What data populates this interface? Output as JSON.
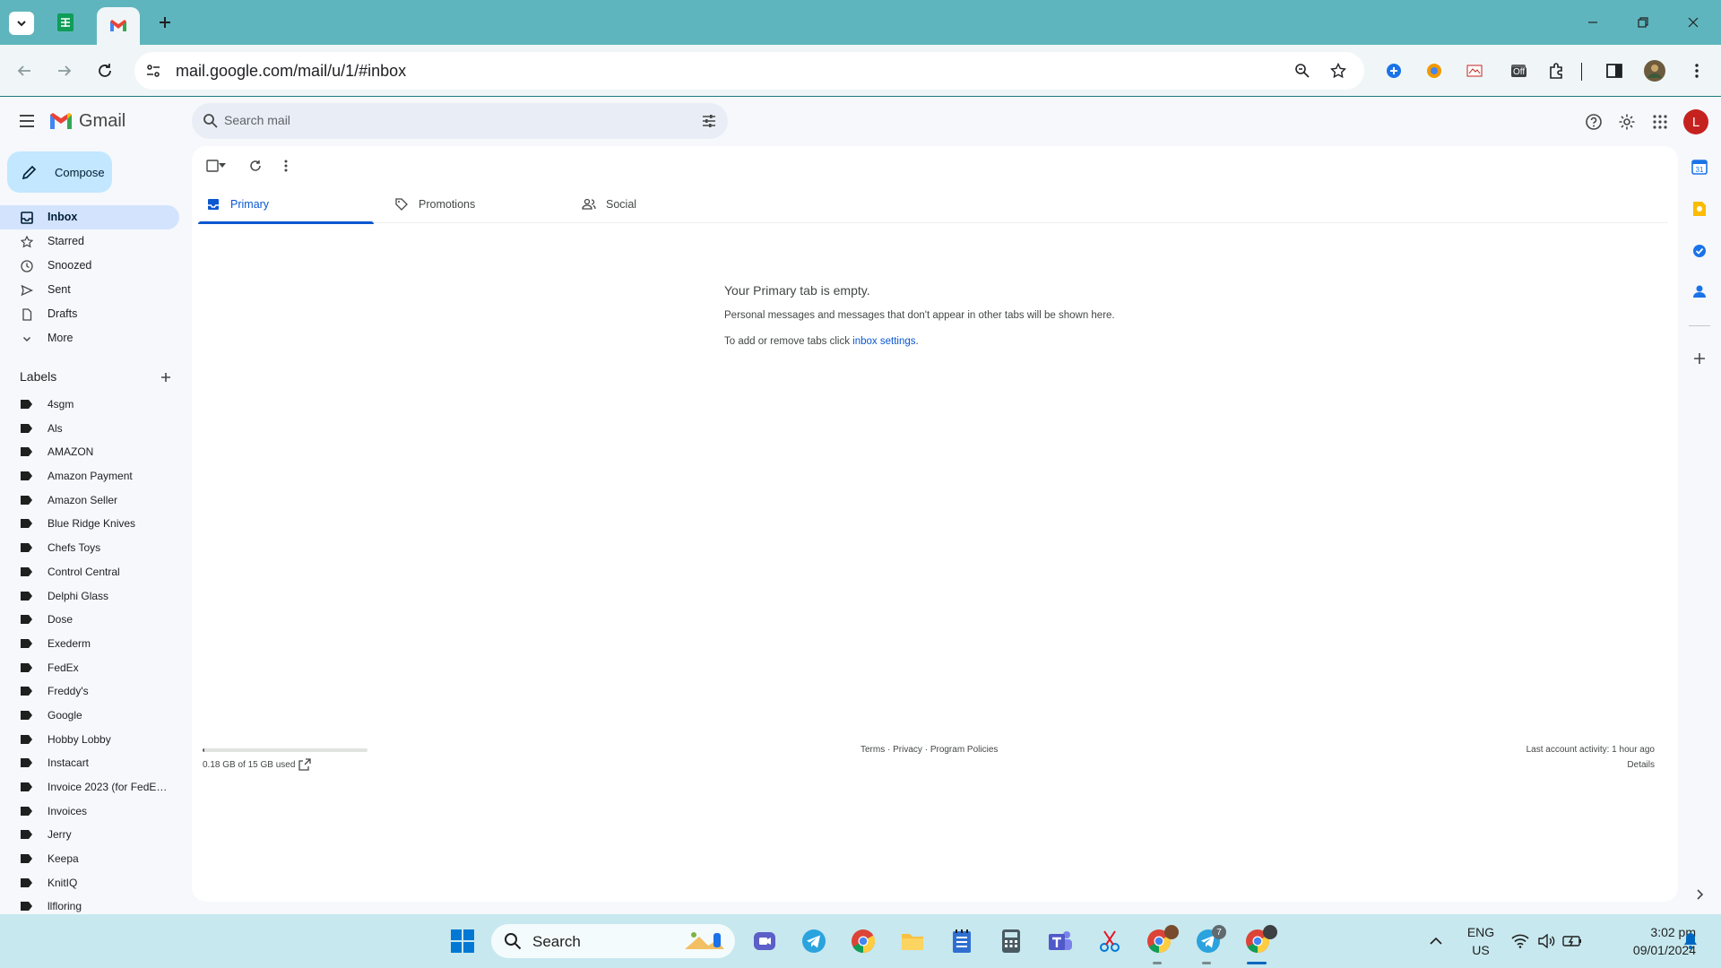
{
  "browser": {
    "url": "mail.google.com/mail/u/1/#inbox"
  },
  "gmail": {
    "app_name": "Gmail",
    "search_placeholder": "Search mail",
    "avatar_letter": "L",
    "compose_label": "Compose",
    "nav": [
      {
        "label": "Inbox",
        "icon": "inbox-icon",
        "active": true
      },
      {
        "label": "Starred",
        "icon": "star-icon"
      },
      {
        "label": "Snoozed",
        "icon": "clock-icon"
      },
      {
        "label": "Sent",
        "icon": "send-icon"
      },
      {
        "label": "Drafts",
        "icon": "draft-icon"
      },
      {
        "label": "More",
        "icon": "chevron-down-icon"
      }
    ],
    "labels_heading": "Labels",
    "labels": [
      "4sgm",
      "Als",
      "AMAZON",
      "Amazon Payment",
      "Amazon Seller",
      "Blue Ridge Knives",
      "Chefs Toys",
      "Control Central",
      "Delphi Glass",
      "Dose",
      "Exederm",
      "FedEx",
      "Freddy's",
      "Google",
      "Hobby Lobby",
      "Instacart",
      "Invoice 2023 (for FedEx ...",
      "Invoices",
      "Jerry",
      "Keepa",
      "KnitIQ",
      "llfloring"
    ],
    "tabs": [
      {
        "label": "Primary",
        "icon": "inbox-tab-icon",
        "active": true
      },
      {
        "label": "Promotions",
        "icon": "tag-icon"
      },
      {
        "label": "Social",
        "icon": "people-icon"
      }
    ],
    "empty": {
      "title": "Your Primary tab is empty.",
      "description": "Personal messages and messages that don't appear in other tabs will be shown here.",
      "hint_prefix": "To add or remove tabs click ",
      "hint_link": "inbox settings",
      "hint_suffix": "."
    },
    "footer": {
      "storage_used": "0.18 GB of 15 GB used",
      "storage_fraction": 0.012,
      "terms": "Terms",
      "privacy": "Privacy",
      "program_policies": "Program Policies",
      "separator": " · ",
      "last_activity": "Last account activity: 1 hour ago",
      "details": "Details"
    }
  },
  "taskbar": {
    "search_label": "Search",
    "language": "ENG",
    "region": "US",
    "time": "3:02 pm",
    "date": "09/01/2024",
    "telegram_badge": "7"
  },
  "extensions": {
    "off_badge": "Off"
  },
  "colors": {
    "tab_strip": "#5fb5bd",
    "toolbar": "#f0f6f7",
    "compose_bg": "#c2e7ff",
    "active_nav": "#d3e3fd",
    "accent_blue": "#0b57d0",
    "gmail_red": "#ea4335",
    "avatar_red": "#c5221f",
    "taskbar": "#c7e8ee"
  }
}
